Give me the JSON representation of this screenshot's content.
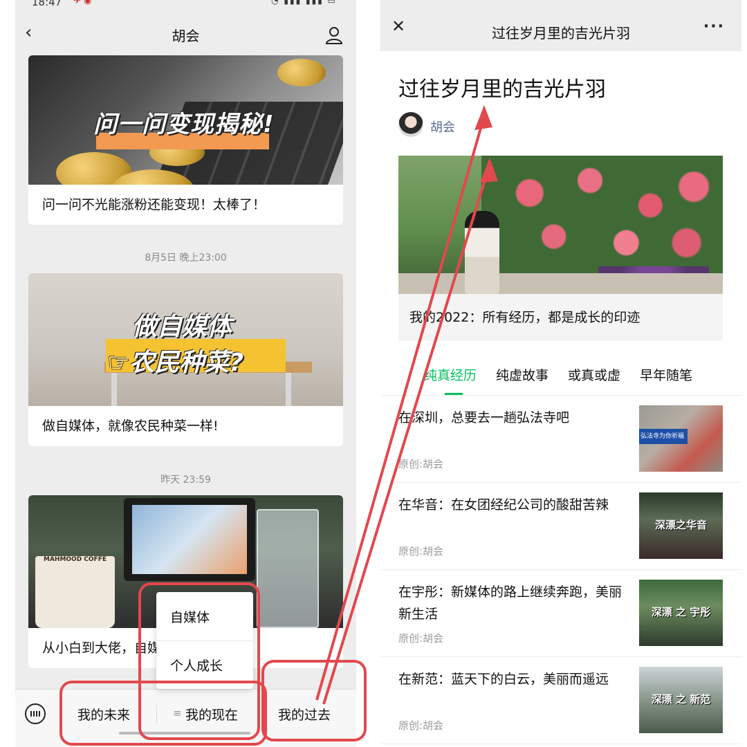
{
  "left": {
    "status_time": "18:47",
    "nav_title": "胡会",
    "cards": [
      {
        "cover_text": "问一问变现揭秘!",
        "caption": "问一问不光能涨粉还能变现！太棒了！"
      },
      {
        "cover_line1": "做自媒体",
        "cover_line2": "☞农民种菜?",
        "caption": "做自媒体，就像农民种菜一样!"
      },
      {
        "mug_text": "MAHMOOD COFFE",
        "caption": "从小白到大佬，自媒体工具大全!"
      }
    ],
    "timestamps": [
      "8月5日 晚上23:00",
      "昨天 23:59"
    ],
    "popup_items": [
      "自媒体",
      "个人成长"
    ],
    "menu": {
      "item1": "我的未来",
      "item2_icon": "≡",
      "item2": "我的现在",
      "item3": "我的过去"
    }
  },
  "right": {
    "nav_title": "过往岁月里的吉光片羽",
    "more": "···",
    "page_title": "过往岁月里的吉光片羽",
    "author": "胡会",
    "cover_caption": "我的2022：所有经历，都是成长的印迹",
    "tabs": [
      "纯真经历",
      "纯虚故事",
      "或真或虚",
      "早年随笔"
    ],
    "articles": [
      {
        "title": "在深圳，总要去一趟弘法寺吧",
        "source": "原创:胡会",
        "thumb_text": "弘法寺为你祈福"
      },
      {
        "title": "在华音：在女团经纪公司的酸甜苦辣",
        "source": "原创:胡会",
        "thumb_text": "深漂之华音"
      },
      {
        "title": "在宇彤：新媒体的路上继续奔跑，美丽新生活",
        "source": "原创:胡会",
        "thumb_text": "深漂 之 宇彤"
      },
      {
        "title": "在新范：蓝天下的白云，美丽而遥远",
        "source": "原创:胡会",
        "thumb_text": "深漂 之 新范"
      }
    ]
  },
  "colors": {
    "accent_green": "#07c160",
    "annotation_red": "#e2484d",
    "link_blue": "#576b95"
  }
}
